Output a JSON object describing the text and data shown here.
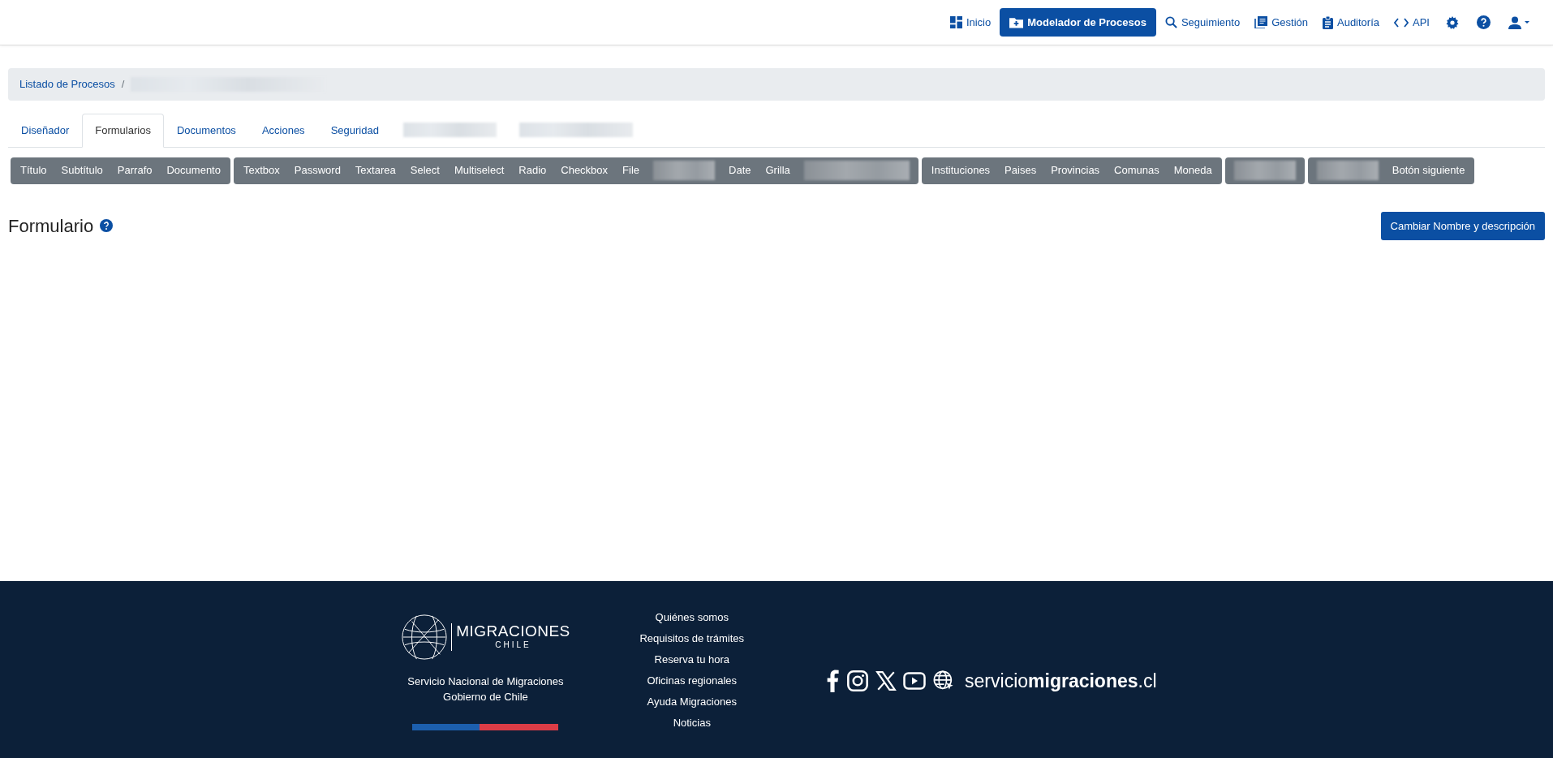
{
  "navbar": {
    "items": [
      {
        "label": "Inicio",
        "selected": false
      },
      {
        "label": "Modelador de Procesos",
        "selected": true
      },
      {
        "label": "Seguimiento",
        "selected": false
      },
      {
        "label": "Gestión",
        "selected": false
      },
      {
        "label": "Auditoría",
        "selected": false
      },
      {
        "label": "API",
        "selected": false
      }
    ]
  },
  "breadcrumb": {
    "separator": "/",
    "items": [
      {
        "kind": "link",
        "label": "Listado de Procesos"
      },
      {
        "kind": "redacted"
      }
    ]
  },
  "tabs": [
    {
      "kind": "tab",
      "label": "Diseñador",
      "selected": false
    },
    {
      "kind": "tab",
      "label": "Formularios",
      "selected": true
    },
    {
      "kind": "tab",
      "label": "Documentos",
      "selected": false
    },
    {
      "kind": "tab",
      "label": "Acciones",
      "selected": false
    },
    {
      "kind": "tab",
      "label": "Seguridad",
      "selected": false
    },
    {
      "kind": "redacted"
    },
    {
      "kind": "redacted"
    }
  ],
  "toolbar": {
    "groups": [
      {
        "items": [
          {
            "kind": "button",
            "label": "Título"
          },
          {
            "kind": "button",
            "label": "Subtítulo"
          },
          {
            "kind": "button",
            "label": "Parrafo"
          },
          {
            "kind": "button",
            "label": "Documento"
          }
        ]
      },
      {
        "items": [
          {
            "kind": "button",
            "label": "Textbox"
          },
          {
            "kind": "button",
            "label": "Password"
          },
          {
            "kind": "button",
            "label": "Textarea"
          },
          {
            "kind": "button",
            "label": "Select"
          },
          {
            "kind": "button",
            "label": "Multiselect"
          },
          {
            "kind": "button",
            "label": "Radio"
          },
          {
            "kind": "button",
            "label": "Checkbox"
          },
          {
            "kind": "button",
            "label": "File"
          },
          {
            "kind": "redacted"
          },
          {
            "kind": "button",
            "label": "Date"
          },
          {
            "kind": "button",
            "label": "Grilla"
          },
          {
            "kind": "redacted"
          }
        ]
      },
      {
        "items": [
          {
            "kind": "button",
            "label": "Instituciones"
          },
          {
            "kind": "button",
            "label": "Paises"
          },
          {
            "kind": "button",
            "label": "Provincias"
          },
          {
            "kind": "button",
            "label": "Comunas"
          },
          {
            "kind": "button",
            "label": "Moneda"
          }
        ]
      },
      {
        "items": [
          {
            "kind": "redacted"
          }
        ]
      },
      {
        "items": [
          {
            "kind": "redacted"
          },
          {
            "kind": "button",
            "label": "Botón siguiente"
          }
        ]
      }
    ]
  },
  "page": {
    "title": "Formulario",
    "action_button": "Cambiar Nombre y descripción"
  },
  "footer": {
    "logo": {
      "name": "MIGRACIONES",
      "subtitle": "CHILE"
    },
    "org_lines": [
      "Servicio Nacional de Migraciones",
      "Gobierno de Chile"
    ],
    "links": [
      "Quiénes somos",
      "Requisitos de trámites",
      "Reserva tu hora",
      "Oficinas regionales",
      "Ayuda Migraciones",
      "Noticias"
    ],
    "site": "servicio**migraciones**.cl"
  }
}
